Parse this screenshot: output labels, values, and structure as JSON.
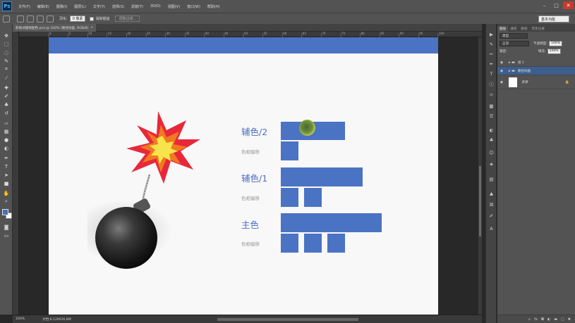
{
  "app": {
    "logo": "Ps",
    "menu": [
      "文件(F)",
      "编辑(E)",
      "图像(I)",
      "图层(L)",
      "文字(Y)",
      "选择(S)",
      "滤镜(T)",
      "3D(D)",
      "视图(V)",
      "窗口(W)",
      "帮助(H)"
    ],
    "window_controls": [
      "–",
      "□",
      "✕"
    ]
  },
  "options_bar": {
    "feather_label": "羽化:",
    "feather_value": "0 像素",
    "antialias_label": "消除锯齿",
    "refine_edge": "调整边缘...",
    "workspace": "基本功能"
  },
  "document_tab": {
    "title": "影视式输频配色.psd @ 100% (路径动画, RGB/8)",
    "close": "×"
  },
  "ruler": {
    "numbers": [
      "0",
      "5",
      "10",
      "15",
      "20",
      "25",
      "30",
      "35",
      "40",
      "45",
      "50",
      "55",
      "60",
      "65",
      "70",
      "75",
      "80",
      "85",
      "90",
      "95",
      "100"
    ]
  },
  "canvas": {
    "band_color": "#4a73c4",
    "rows": [
      {
        "title": "辅色/2",
        "sub": "色相偏移"
      },
      {
        "title": "辅色/1",
        "sub": "色相偏移"
      },
      {
        "title": "主色",
        "sub": "色相偏移"
      }
    ]
  },
  "statusbar": {
    "zoom": "100%",
    "docsize": "文档:6.12M/26.8M"
  },
  "layers_panel": {
    "tabs": [
      "图层",
      "通道",
      "路径",
      "历史记录"
    ],
    "filter": "类型",
    "blend_mode": "正常",
    "opacity_label": "不透明度:",
    "opacity_value": "100%",
    "lock_label": "锁定:",
    "fill_label": "填充:",
    "fill_value": "100%",
    "layers": [
      {
        "name": "组 1",
        "selected": false
      },
      {
        "name": "路径动画",
        "selected": true
      },
      {
        "name": "背景",
        "selected": false
      }
    ]
  },
  "colors": {
    "accent": "#4a73c4",
    "selection": "#3d5f8f"
  }
}
